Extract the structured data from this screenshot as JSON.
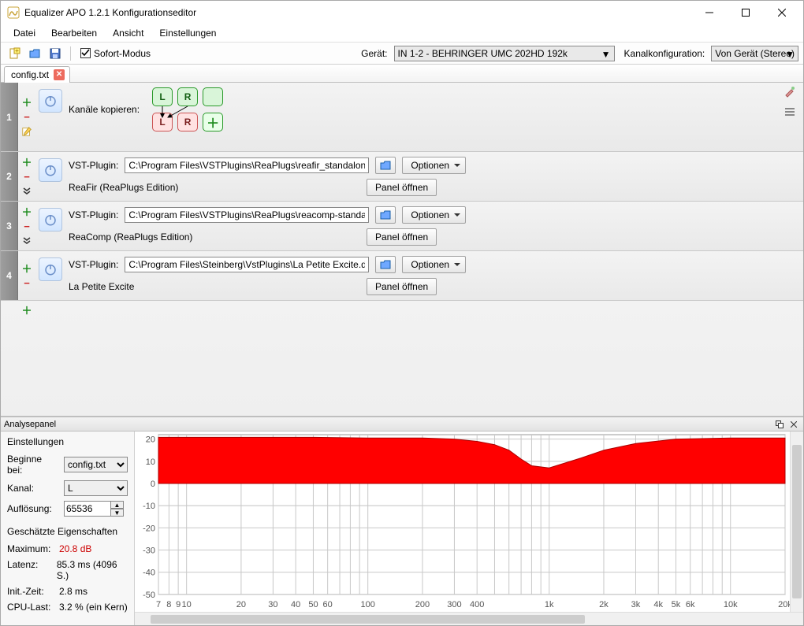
{
  "window": {
    "title": "Equalizer APO 1.2.1 Konfigurationseditor"
  },
  "menu": [
    "Datei",
    "Bearbeiten",
    "Ansicht",
    "Einstellungen"
  ],
  "toolbar": {
    "instant_label": "Sofort-Modus",
    "device_label": "Gerät:",
    "device_value": "IN 1-2 - BEHRINGER UMC 202HD 192k",
    "chancfg_label": "Kanalkonfiguration:",
    "chancfg_value": "Von Gerät (Stereo)"
  },
  "tab": {
    "name": "config.txt"
  },
  "rows": [
    {
      "label": "Kanäle kopieren:",
      "src": [
        "L",
        "R",
        ""
      ],
      "dst": [
        "L",
        "R"
      ]
    },
    {
      "vst_label": "VST-Plugin:",
      "path": "C:\\Program Files\\VSTPlugins\\ReaPlugs\\reafir_standalone.dll",
      "options": "Optionen",
      "name": "ReaFir (ReaPlugs Edition)",
      "panel": "Panel öffnen"
    },
    {
      "vst_label": "VST-Plugin:",
      "path": "C:\\Program Files\\VSTPlugins\\ReaPlugs\\reacomp-standalone.dll",
      "options": "Optionen",
      "name": "ReaComp (ReaPlugs Edition)",
      "panel": "Panel öffnen"
    },
    {
      "vst_label": "VST-Plugin:",
      "path": "C:\\Program Files\\Steinberg\\VstPlugins\\La Petite Excite.dll",
      "options": "Optionen",
      "name": "La Petite Excite",
      "panel": "Panel öffnen"
    }
  ],
  "analysis": {
    "title": "Analysepanel",
    "settings_hdr": "Einstellungen",
    "begin_label": "Beginne bei:",
    "begin_value": "config.txt",
    "channel_label": "Kanal:",
    "channel_value": "L",
    "res_label": "Auflösung:",
    "res_value": "65536",
    "est_hdr": "Geschätzte Eigenschaften",
    "max_label": "Maximum:",
    "max_value": "20.8 dB",
    "lat_label": "Latenz:",
    "lat_value": "85.3 ms (4096 S.)",
    "init_label": "Init.-Zeit:",
    "init_value": "2.8 ms",
    "cpu_label": "CPU-Last:",
    "cpu_value": "3.2 % (ein Kern)"
  },
  "chart_data": {
    "type": "line",
    "title": "",
    "xlabel": "",
    "ylabel": "",
    "ylim": [
      -50,
      22
    ],
    "x_ticks": [
      7,
      8,
      9,
      10,
      20,
      30,
      40,
      50,
      60,
      100,
      200,
      300,
      400,
      1000,
      2000,
      3000,
      4000,
      5000,
      6000,
      10000,
      20000
    ],
    "x_tick_labels": [
      "7",
      "8",
      "9",
      "10",
      "20",
      "30",
      "40",
      "50",
      "60",
      "100",
      "200",
      "300",
      "400",
      "1k",
      "2k",
      "3k",
      "4k",
      "5k",
      "6k",
      "10k",
      "20k"
    ],
    "y_ticks": [
      20,
      10,
      0,
      -10,
      -20,
      -30,
      -40,
      -50
    ],
    "x": [
      7,
      10,
      20,
      50,
      100,
      200,
      300,
      400,
      500,
      600,
      700,
      800,
      1000,
      1500,
      2000,
      3000,
      5000,
      10000,
      20000
    ],
    "values": [
      20.8,
      20.8,
      20.8,
      20.8,
      20.5,
      20.5,
      20,
      19,
      17.5,
      15,
      11,
      8,
      7,
      11.5,
      15,
      18,
      20,
      20.5,
      20.5
    ],
    "fill_color": "#ff0000"
  }
}
